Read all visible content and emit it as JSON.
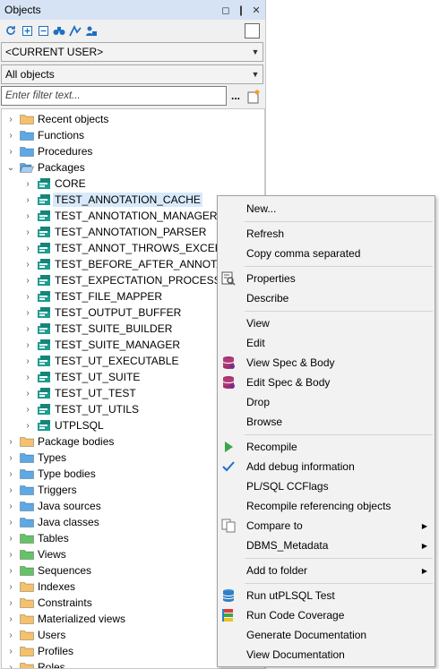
{
  "panel": {
    "title": "Objects",
    "title_buttons": [
      "◻",
      "❙",
      "✕"
    ],
    "owner_combo": "<CURRENT USER>",
    "type_combo": "All objects",
    "filter_placeholder": "Enter filter text...",
    "filter_more": "..."
  },
  "tree": {
    "categories_top": [
      "Recent objects",
      "Functions",
      "Procedures",
      "Packages"
    ],
    "packages": [
      "CORE",
      "TEST_ANNOTATION_CACHE",
      "TEST_ANNOTATION_MANAGER",
      "TEST_ANNOTATION_PARSER",
      "TEST_ANNOT_THROWS_EXCEPTIONS",
      "TEST_BEFORE_AFTER_ANNOTATIONS",
      "TEST_EXPECTATION_PROCESSOR",
      "TEST_FILE_MAPPER",
      "TEST_OUTPUT_BUFFER",
      "TEST_SUITE_BUILDER",
      "TEST_SUITE_MANAGER",
      "TEST_UT_EXECUTABLE",
      "TEST_UT_SUITE",
      "TEST_UT_TEST",
      "TEST_UT_UTILS",
      "UTPLSQL"
    ],
    "categories_bottom": [
      "Package bodies",
      "Types",
      "Type bodies",
      "Triggers",
      "Java sources",
      "Java classes",
      "Tables",
      "Views",
      "Sequences",
      "Indexes",
      "Constraints",
      "Materialized views",
      "Users",
      "Profiles",
      "Roles"
    ],
    "folder_colors_bottom": [
      "#f5c16c",
      "#5ca8e8",
      "#5ca8e8",
      "#5ca8e8",
      "#5ca8e8",
      "#5ca8e8",
      "#66c266",
      "#66c266",
      "#66c266",
      "#f5c16c",
      "#f5c16c",
      "#f5c16c",
      "#f5c16c",
      "#f5c16c",
      "#f5c16c"
    ]
  },
  "context_menu": {
    "items": [
      {
        "label": "New...",
        "icon": ""
      },
      {
        "label": "Refresh",
        "icon": ""
      },
      {
        "label": "Copy comma separated",
        "icon": ""
      },
      {
        "label": "Properties",
        "icon": "properties-icon"
      },
      {
        "label": "Describe",
        "icon": ""
      },
      {
        "label": "View",
        "icon": ""
      },
      {
        "label": "Edit",
        "icon": ""
      },
      {
        "label": "View Spec & Body",
        "icon": "spec-body-icon"
      },
      {
        "label": "Edit Spec & Body",
        "icon": "spec-body-icon"
      },
      {
        "label": "Drop",
        "icon": ""
      },
      {
        "label": "Browse",
        "icon": ""
      },
      {
        "label": "Recompile",
        "icon": "play-icon"
      },
      {
        "label": "Add debug information",
        "icon": "check-icon"
      },
      {
        "label": "PL/SQL CCFlags",
        "icon": ""
      },
      {
        "label": "Recompile referencing objects",
        "icon": ""
      },
      {
        "label": "Compare to",
        "icon": "compare-icon",
        "submenu": true
      },
      {
        "label": "DBMS_Metadata",
        "icon": "",
        "submenu": true
      },
      {
        "label": "Add to folder",
        "icon": "",
        "submenu": true
      },
      {
        "label": "Run utPLSQL Test",
        "icon": "database-icon"
      },
      {
        "label": "Run Code Coverage",
        "icon": "coverage-icon"
      },
      {
        "label": "Generate Documentation",
        "icon": ""
      },
      {
        "label": "View Documentation",
        "icon": ""
      }
    ]
  },
  "colors": {
    "accent": "#1e6fc4",
    "selection": "#d7e9fa",
    "folder_yellow": "#f5c16c",
    "folder_blue": "#5ca8e8",
    "folder_green": "#66c266",
    "package_teal": "#1a9e8f"
  }
}
